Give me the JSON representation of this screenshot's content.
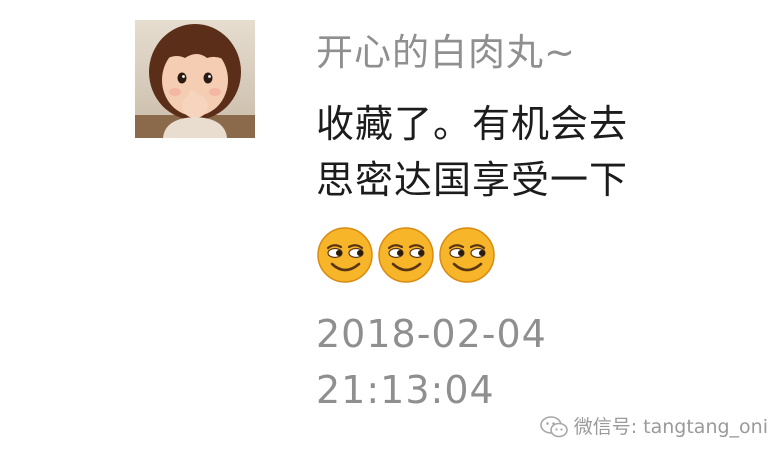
{
  "comment": {
    "nickname": "开心的白肉丸~",
    "message_lines": [
      "收藏了。有机会去",
      "思密达国享受一下"
    ],
    "emojis": [
      "smirk-emoji",
      "smirk-emoji",
      "smirk-emoji"
    ],
    "date": "2018-02-04",
    "time": "21:13:04"
  },
  "watermark": {
    "icon": "wechat-icon",
    "text": "微信号: tangtang_oni"
  },
  "colors": {
    "nickname": "#8f8f8f",
    "message": "#1c1c1c",
    "timestamp": "#8f8f8f",
    "emoji_face": "#f7b52a"
  }
}
